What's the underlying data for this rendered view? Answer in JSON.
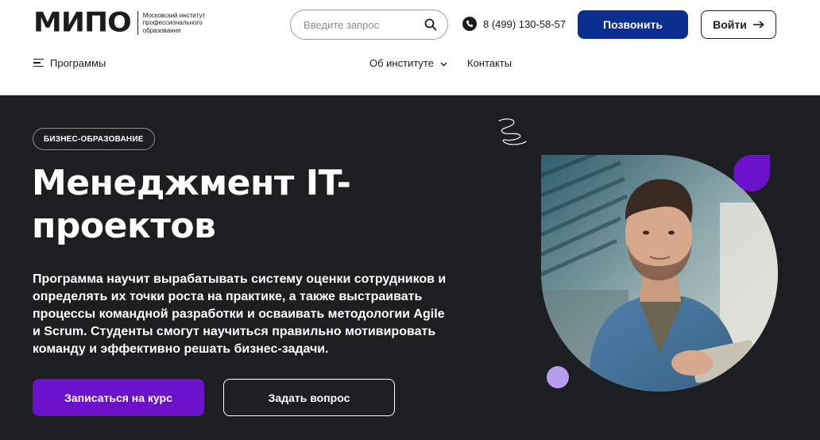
{
  "header": {
    "logo": {
      "word": "МИПО",
      "description": "Московский институт профессионального образования"
    },
    "search": {
      "placeholder": "Введите запрос",
      "icon": "search-icon"
    },
    "phone": {
      "number": "8 (499) 130-58-57",
      "icon": "phone-icon"
    },
    "call_button": "Позвонить",
    "login_button": "Войти",
    "login_icon": "arrow-right-icon",
    "nav": {
      "programs": "Программы",
      "about": "Об институте",
      "contacts": "Контакты"
    }
  },
  "hero": {
    "tag": "БИЗНЕС-ОБРАЗОВАНИЕ",
    "title": "Менеджмент IT-проектов",
    "description": "Программа научит вырабатывать систему оценки сотрудников и определять их точки роста на практике, а также выстраивать процессы командной разработки и осваивать методологии Agile и Scrum. Студенты смогут научиться правильно мотивировать команду и эффективно решать бизнес-задачи.",
    "enroll_button": "Записаться на курс",
    "ask_button": "Задать вопрос"
  },
  "colors": {
    "brand_blue": "#0a2d8f",
    "accent_purple": "#6b11c9",
    "lilac": "#b89cf0",
    "hero_bg": "#1d1e22"
  }
}
